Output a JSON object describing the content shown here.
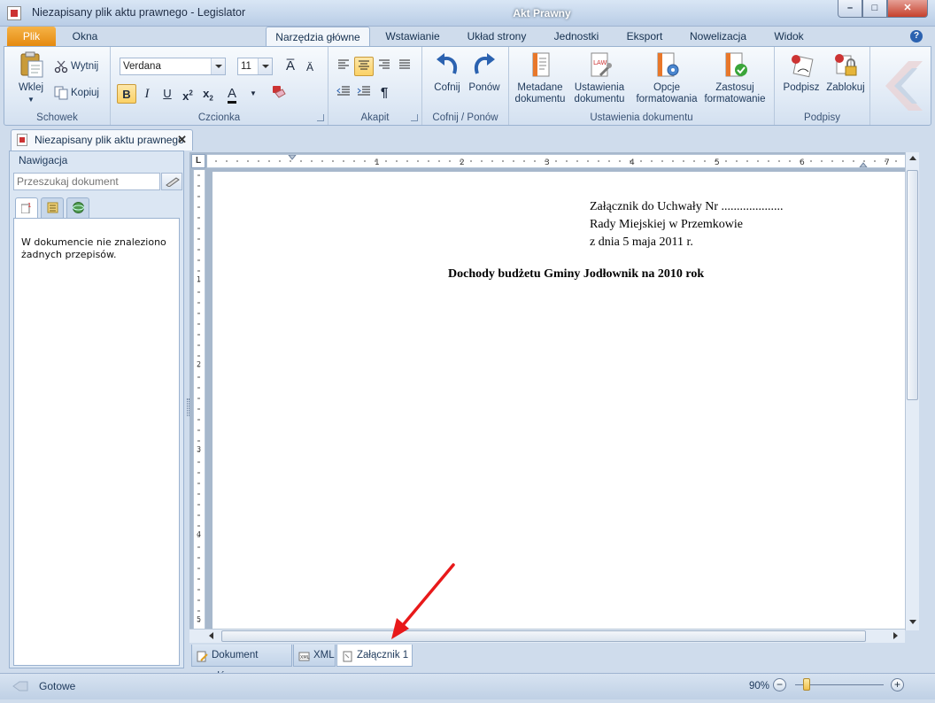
{
  "window": {
    "title": "Niezapisany plik aktu prawnego - Legislator",
    "context_title": "Akt Prawny"
  },
  "ribbon_tabs": {
    "file": "Plik",
    "items": [
      "Okna",
      "Narzędzia główne",
      "Wstawianie",
      "Układ strony",
      "Jednostki",
      "Eksport",
      "Nowelizacja",
      "Widok"
    ],
    "active": "Narzędzia główne"
  },
  "groups": {
    "clipboard": {
      "label": "Schowek",
      "paste": "Wklej",
      "cut": "Wytnij",
      "copy": "Kopiuj"
    },
    "font": {
      "label": "Czcionka",
      "family": "Verdana",
      "size": "11"
    },
    "paragraph": {
      "label": "Akapit"
    },
    "undo": {
      "label": "Cofnij / Ponów",
      "undo": "Cofnij",
      "redo": "Ponów"
    },
    "doc_settings": {
      "label": "Ustawienia dokumentu",
      "metadata": [
        "Metadane",
        "dokumentu"
      ],
      "settings": [
        "Ustawienia",
        "dokumentu"
      ],
      "format_options": [
        "Opcje",
        "formatowania"
      ],
      "apply_format": [
        "Zastosuj",
        "formatowanie"
      ]
    },
    "signatures": {
      "label": "Podpisy",
      "sign": "Podpisz",
      "lock": "Zablokuj"
    }
  },
  "doc_tab": {
    "label": "Niezapisany plik aktu prawnego"
  },
  "navigation": {
    "title": "Nawigacja",
    "search_placeholder": "Przeszukaj dokument",
    "message": "W dokumencie nie znaleziono żadnych przepisów."
  },
  "ruler": {
    "h_numbers": [
      "1",
      "2",
      "3",
      "4",
      "5",
      "6",
      "7"
    ],
    "v_numbers": [
      "1",
      "2",
      "3",
      "4",
      "5"
    ]
  },
  "document": {
    "lines": [
      "Załącznik do Uchwały Nr ....................",
      "Rady Miejskiej w Przemkowie",
      "z dnia 5 maja 2011 r."
    ],
    "heading": "Dochody budżetu Gminy Jodłownik na 2010 rok"
  },
  "bottom_tabs": [
    "Dokument główny",
    "XML",
    "Załącznik 1"
  ],
  "status": {
    "text": "Gotowe",
    "zoom": "90%",
    "zoom_level": 0.1
  },
  "colors": {
    "accent": "#e58a10",
    "annotation_arrow": "#e8191a"
  }
}
